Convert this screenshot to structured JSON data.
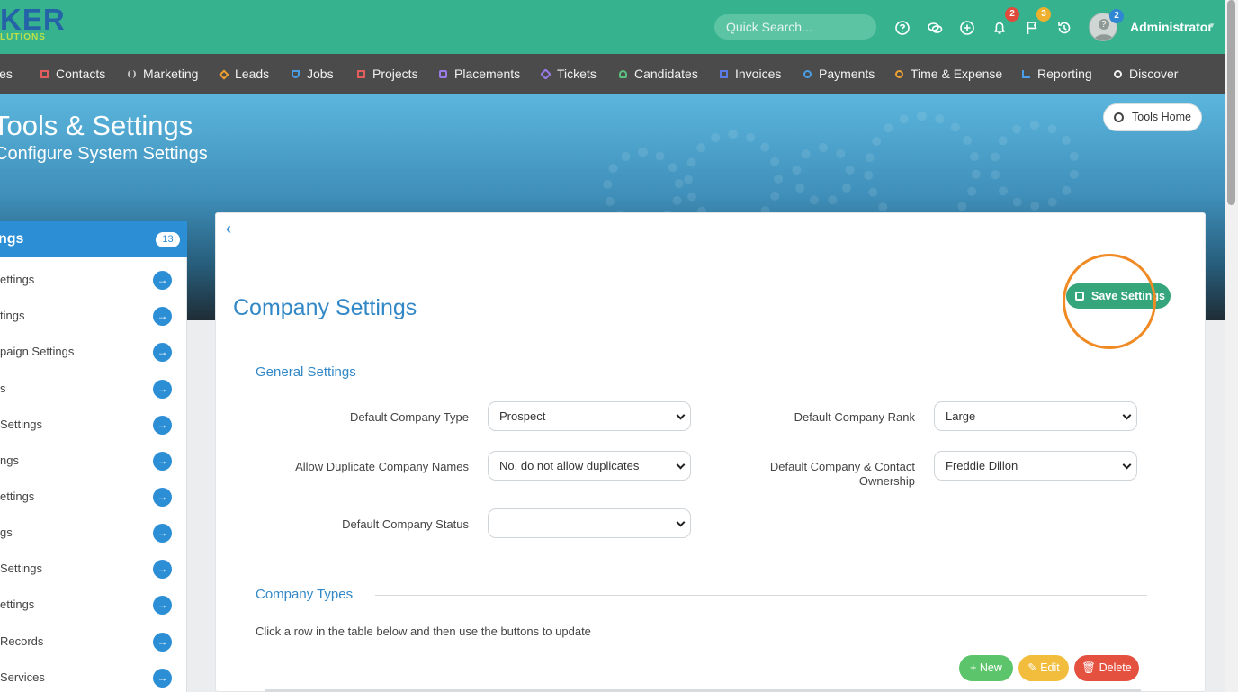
{
  "brand": {
    "logo_text": "KER",
    "logo_sub": "LUTIONS"
  },
  "search": {
    "placeholder": "Quick Search..."
  },
  "top_icons": {
    "help": "question-circle-icon",
    "chat": "chat-bubbles-icon",
    "add": "plus-circle-icon",
    "bell": "bell-icon",
    "bell_count": "2",
    "flag": "flag-icon",
    "flag_count": "3",
    "history": "history-icon",
    "avatar_count": "2"
  },
  "user": {
    "name": "Administrator"
  },
  "nav": {
    "items": [
      {
        "label": "ies",
        "icon": "building-icon",
        "color": "#cfcfcf"
      },
      {
        "label": "Contacts",
        "icon": "contact-card-icon",
        "color": "#e35d5d"
      },
      {
        "label": "Marketing",
        "icon": "broadcast-icon",
        "color": "#bdbdbd"
      },
      {
        "label": "Leads",
        "icon": "diamond-icon",
        "color": "#f0a030"
      },
      {
        "label": "Jobs",
        "icon": "trophy-icon",
        "color": "#4a9ee8"
      },
      {
        "label": "Projects",
        "icon": "checklist-icon",
        "color": "#e35d5d"
      },
      {
        "label": "Placements",
        "icon": "briefcase-icon",
        "color": "#9a7be8"
      },
      {
        "label": "Tickets",
        "icon": "tag-icon",
        "color": "#9a7be8"
      },
      {
        "label": "Candidates",
        "icon": "user-icon",
        "color": "#5cc080"
      },
      {
        "label": "Invoices",
        "icon": "invoice-icon",
        "color": "#5a7be8"
      },
      {
        "label": "Payments",
        "icon": "payment-icon",
        "color": "#4a9ee8"
      },
      {
        "label": "Time & Expense",
        "icon": "clock-icon",
        "color": "#f0a030"
      },
      {
        "label": "Reporting",
        "icon": "bar-chart-icon",
        "color": "#4a9ee8"
      },
      {
        "label": "Discover",
        "icon": "search-icon",
        "color": "#f2f2f2"
      }
    ]
  },
  "header": {
    "title": "Tools & Settings",
    "subtitle": "Configure System Settings",
    "tools_home_label": "Tools Home"
  },
  "sidebar": {
    "title": "ngs",
    "count": "13",
    "items": [
      {
        "label": "ettings"
      },
      {
        "label": "tings"
      },
      {
        "label": "paign Settings"
      },
      {
        "label": "s"
      },
      {
        "label": "Settings"
      },
      {
        "label": "ngs"
      },
      {
        "label": "ettings"
      },
      {
        "label": "gs"
      },
      {
        "label": "Settings"
      },
      {
        "label": "ettings"
      },
      {
        "label": "Records"
      },
      {
        "label": "Services"
      }
    ]
  },
  "main": {
    "title": "Company Settings",
    "save_label": "Save Settings",
    "general_section": "General Settings",
    "fields": {
      "default_company_type": {
        "label": "Default Company Type",
        "value": "Prospect"
      },
      "allow_duplicate": {
        "label": "Allow Duplicate Company Names",
        "value": "No, do not allow duplicates"
      },
      "default_company_status": {
        "label": "Default Company Status",
        "value": ""
      },
      "default_company_rank": {
        "label": "Default Company Rank",
        "value": "Large"
      },
      "default_ownership": {
        "label_line1": "Default Company & Contact",
        "label_line2": "Ownership",
        "value": "Freddie Dillon"
      }
    },
    "types_section": "Company Types",
    "hint": "Click a row in the table below and then use the buttons to update",
    "buttons": {
      "new_label": "New",
      "edit_label": "Edit",
      "delete_label": "Delete"
    }
  },
  "colors": {
    "topbar": "#36b38e",
    "navbar": "#4b4b4b",
    "accent_blue": "#3288c6",
    "sidebar_header": "#2c8fd6",
    "save_green": "#35a57c",
    "new_green": "#5cc46a",
    "edit_yellow": "#f2bd3c",
    "delete_red": "#e4513f",
    "highlight_orange": "#f08a24"
  }
}
